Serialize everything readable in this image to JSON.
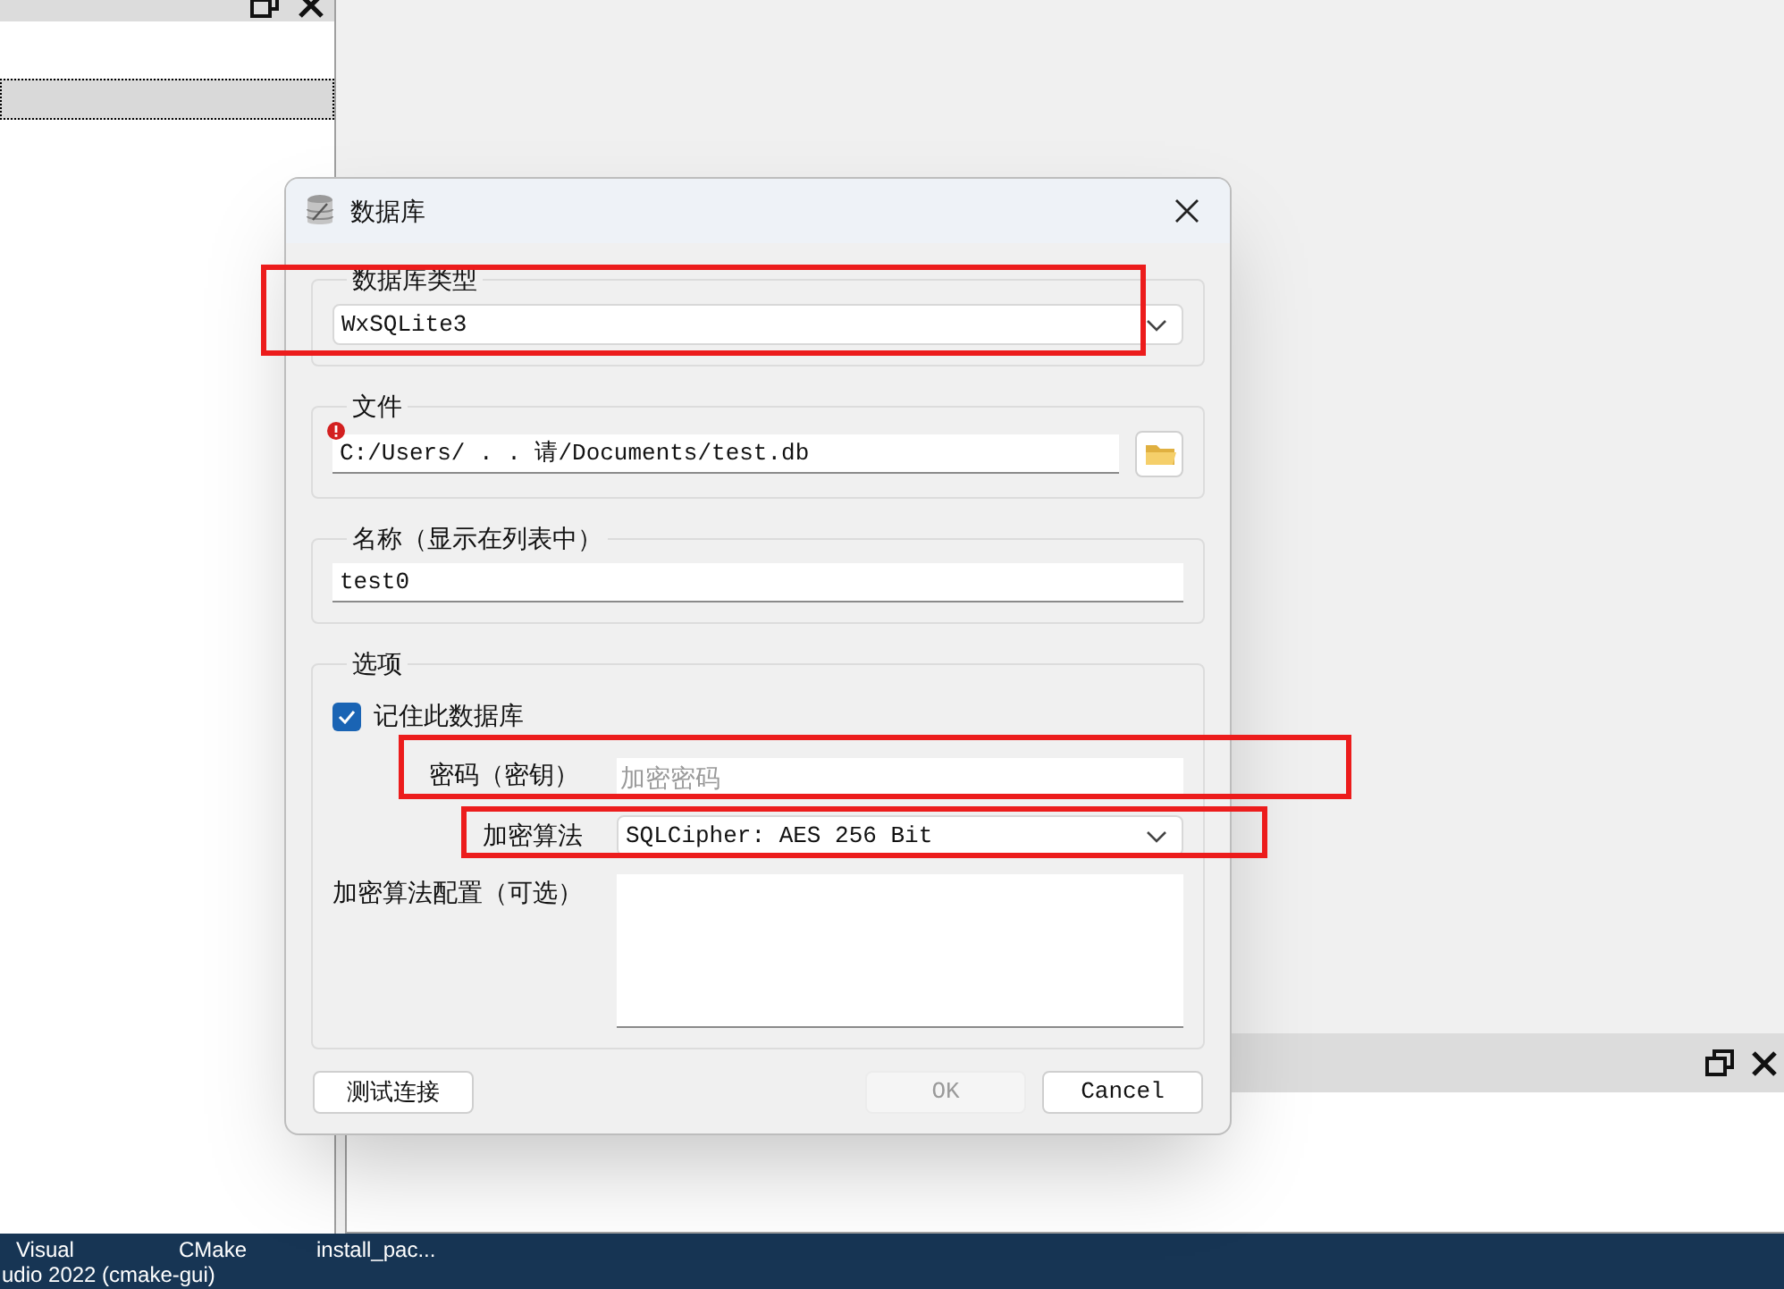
{
  "left_panel": {
    "rows": [
      {
        "selected": true
      }
    ]
  },
  "dialog": {
    "title": "数据库",
    "groups": [
      {
        "kind": "combo",
        "legend": "数据库类型",
        "value": "WxSQLite3",
        "highlighted": true
      },
      {
        "kind": "file",
        "legend": "文件",
        "value": "C:/Users/ . . 请/Documents/test.db",
        "error": true
      },
      {
        "kind": "text",
        "legend": "名称（显示在列表中）",
        "value": "test0"
      },
      {
        "kind": "options",
        "legend": "选项",
        "remember": {
          "label": "记住此数据库",
          "checked": true
        },
        "password": {
          "label": "密码（密钥）",
          "placeholder": "加密密码",
          "highlighted": true
        },
        "cipher": {
          "label": "加密算法",
          "value": "SQLCipher: AES 256 Bit",
          "highlighted": true
        },
        "cipher_config": {
          "label": "加密算法配置（可选）"
        }
      }
    ],
    "buttons": [
      {
        "label": "测试连接",
        "disabled": false
      },
      {
        "label": "OK",
        "disabled": true
      },
      {
        "label": "Cancel",
        "disabled": false
      }
    ]
  },
  "taskbar": {
    "items": [
      {
        "lines": [
          "Visual",
          "udio 2022  (cmake-gui)"
        ]
      },
      {
        "lines": [
          "CMake"
        ]
      },
      {
        "lines": [
          "install_pac..."
        ]
      }
    ]
  }
}
